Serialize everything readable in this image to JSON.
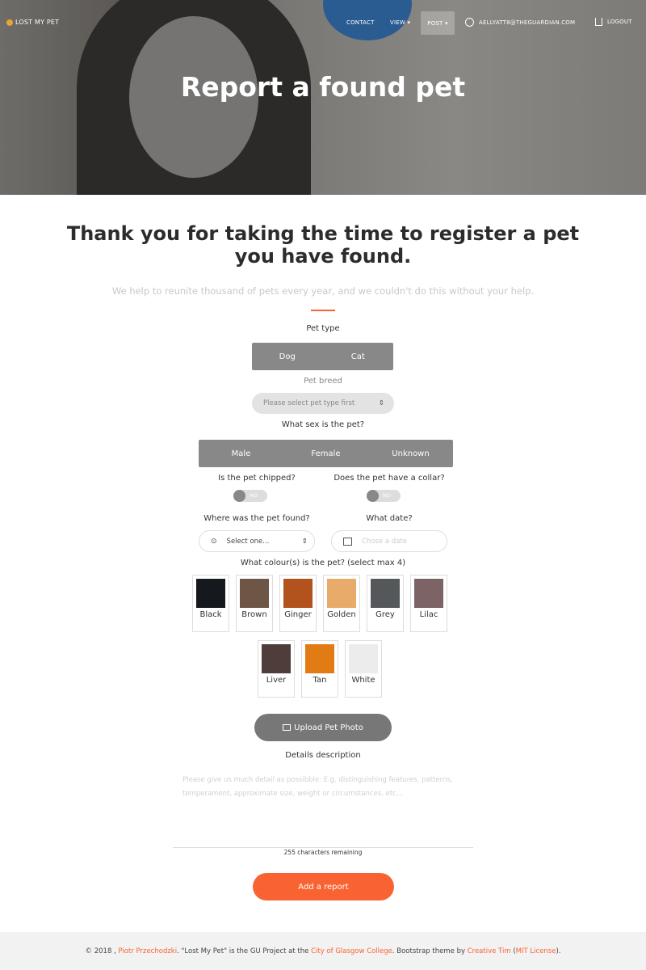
{
  "nav": {
    "brand": "LOST MY PET",
    "contact": "CONTACT",
    "view": "VIEW",
    "post": "POST",
    "user": "AELLYATT8@THEGUARDIAN.COM",
    "logout": "LOGOUT"
  },
  "hero": {
    "title": "Report a found pet"
  },
  "intro": {
    "heading": "Thank you for taking the time to register a pet you have found.",
    "subtitle": "We help to reunite thousand of pets every year, and we couldn't do this without your help."
  },
  "form": {
    "pet_type_label": "Pet type",
    "pet_types": [
      "Dog",
      "Cat"
    ],
    "breed_label": "Pet breed",
    "breed_placeholder": "Please select pet type first",
    "sex_label": "What sex is the pet?",
    "sexes": [
      "Male",
      "Female",
      "Unknown"
    ],
    "chipped_label": "Is the pet chipped?",
    "chipped_value": "NO",
    "collar_label": "Does the pet have a collar?",
    "collar_value": "NO",
    "location_label": "Where was the pet found?",
    "location_placeholder": "Select one...",
    "date_label": "What date?",
    "date_placeholder": "Chose a date",
    "colour_label": "What colour(s) is the pet? (select max 4)",
    "colours": [
      {
        "name": "Black",
        "color": "#15181c"
      },
      {
        "name": "Brown",
        "color": "#6e5647"
      },
      {
        "name": "Ginger",
        "color": "#b2531e"
      },
      {
        "name": "Golden",
        "color": "#e8ab6a"
      },
      {
        "name": "Grey",
        "color": "#55585a"
      },
      {
        "name": "Lilac",
        "color": "#7c6365"
      },
      {
        "name": "Liver",
        "color": "#4e3d3b"
      },
      {
        "name": "Tan",
        "color": "#e17b14"
      },
      {
        "name": "White",
        "color": "#ececec"
      }
    ],
    "upload_label": "Upload Pet Photo",
    "details_label": "Details description",
    "details_placeholder": "Please give us much detail as possibble: E.g. distinguishing features, patterns, temperament, approximate size, weight or circumstances, etc...",
    "remaining": "255 characters remaining",
    "submit": "Add a report"
  },
  "footer": {
    "pre": "© 2018 , ",
    "author": "Piotr Przechodzki",
    "mid": ". \"Lost My Pet\" is the GU Project at the ",
    "college": "City of Glasgow College",
    "mid2": ". Bootstrap theme by ",
    "theme": "Creative Tim",
    "open": " (",
    "license": "MIT License",
    "close": ")."
  },
  "colors": {
    "accent": "#f96332",
    "segment": "#888888"
  }
}
